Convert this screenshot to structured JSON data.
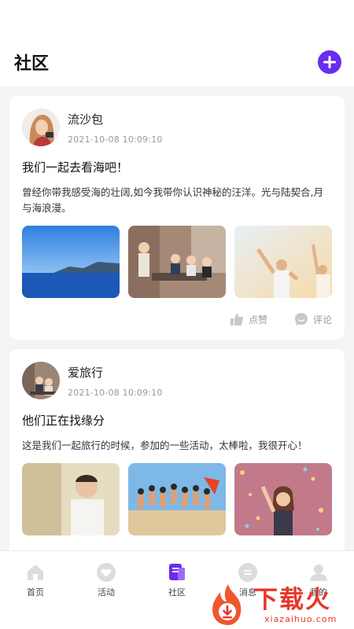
{
  "header": {
    "title": "社区"
  },
  "colors": {
    "accent": "#6a2cf0",
    "brand_watermark": "#e8362a"
  },
  "posts": [
    {
      "username": "流沙包",
      "time": "2021-10-08  10:09:10",
      "title": "我们一起去看海吧！",
      "body": "曾经你带我感受海的壮阔,如今我带你认识神秘的汪洋。光与陆契合,月与海浪漫。",
      "photos": [
        "sea-photo",
        "friends-cafe-photo",
        "beach-party-photo"
      ],
      "like_label": "点赞",
      "comment_label": "评论"
    },
    {
      "username": "爱旅行",
      "time": "2021-10-08  10:09:10",
      "title": "他们正在找缘分",
      "body": "这是我们一起旅行的时候，参加的一些活动，太棒啦，我很开心！",
      "photos": [
        "man-portrait-photo",
        "group-jump-photo",
        "confetti-photo"
      ]
    }
  ],
  "tabbar": {
    "items": [
      {
        "label": "首页",
        "icon": "home-icon"
      },
      {
        "label": "活动",
        "icon": "heart-icon"
      },
      {
        "label": "社区",
        "icon": "community-icon",
        "active": true
      },
      {
        "label": "消息",
        "icon": "message-icon"
      },
      {
        "label": "我的",
        "icon": "profile-icon"
      }
    ]
  },
  "watermark": {
    "cn": "下载火",
    "en": "xiazaihuo.com"
  }
}
